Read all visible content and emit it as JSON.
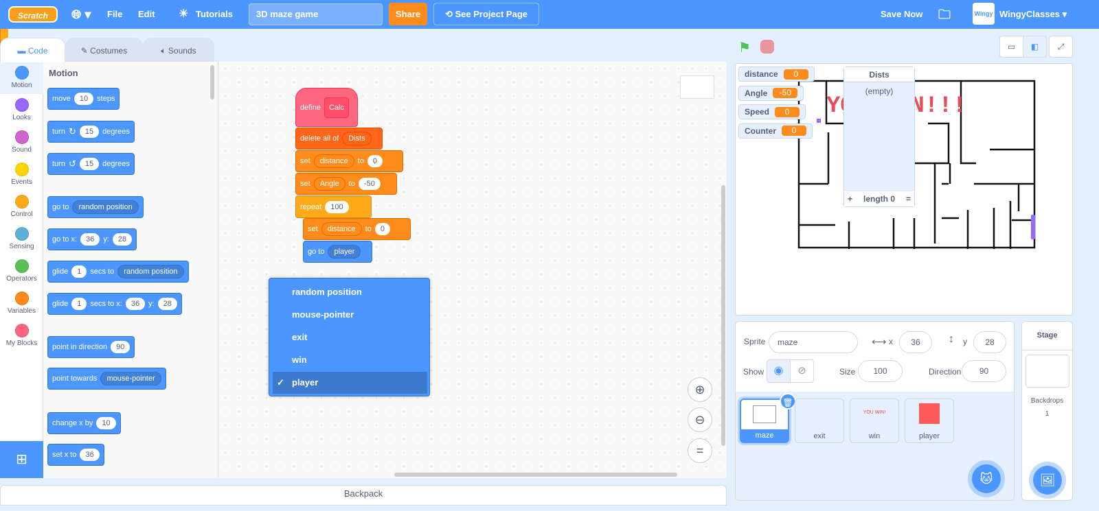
{
  "menubar": {
    "logo": "Scratch",
    "file": "File",
    "edit": "Edit",
    "tutorials": "Tutorials",
    "project_title": "3D maze game",
    "share": "Share",
    "see_project_page": "See Project Page",
    "save_now": "Save Now",
    "username": "WingyClasses",
    "avatar_text": "Wingy"
  },
  "tabs": [
    {
      "label": "Code"
    },
    {
      "label": "Costumes"
    },
    {
      "label": "Sounds"
    }
  ],
  "categories": [
    {
      "label": "Motion",
      "color": "#4c97ff"
    },
    {
      "label": "Looks",
      "color": "#9966ff"
    },
    {
      "label": "Sound",
      "color": "#cf63cf"
    },
    {
      "label": "Events",
      "color": "#ffd500"
    },
    {
      "label": "Control",
      "color": "#ffab19"
    },
    {
      "label": "Sensing",
      "color": "#5cb1d6"
    },
    {
      "label": "Operators",
      "color": "#59c059"
    },
    {
      "label": "Variables",
      "color": "#ff8c1a"
    },
    {
      "label": "My Blocks",
      "color": "#ff6680"
    }
  ],
  "palette": {
    "heading": "Motion",
    "blocks": {
      "move": [
        "move",
        "10",
        "steps"
      ],
      "turn_cw": [
        "turn",
        "15",
        "degrees"
      ],
      "turn_ccw": [
        "turn",
        "15",
        "degrees"
      ],
      "goto": [
        "go to",
        "random position"
      ],
      "gotoxy": [
        "go to x:",
        "36",
        "y:",
        "28"
      ],
      "glide": [
        "glide",
        "1",
        "secs to",
        "random position"
      ],
      "glidexy": [
        "glide",
        "1",
        "secs to x:",
        "36",
        "y:",
        "28"
      ],
      "point": [
        "point in direction",
        "90"
      ],
      "towards": [
        "point towards",
        "mouse-pointer"
      ],
      "changex": [
        "change x by",
        "10"
      ],
      "setx": [
        "set x to",
        "36"
      ]
    }
  },
  "script": {
    "define": [
      "define",
      "Calc"
    ],
    "delete": [
      "delete all of",
      "Dists"
    ],
    "set1": [
      "set",
      "distance",
      "to",
      "0"
    ],
    "set2": [
      "set",
      "Angle",
      "to",
      "-50"
    ],
    "repeat": [
      "repeat",
      "100"
    ],
    "set3": [
      "set",
      "distance",
      "to",
      "0"
    ],
    "goto": [
      "go to",
      "player"
    ]
  },
  "dropdown": {
    "options": [
      {
        "label": "random position"
      },
      {
        "label": "mouse-pointer"
      },
      {
        "label": "exit"
      },
      {
        "label": "win"
      },
      {
        "label": "player",
        "selected": true
      }
    ],
    "check": "✓"
  },
  "backpack": "Backpack",
  "monitors": [
    {
      "name": "distance",
      "value": "0"
    },
    {
      "name": "Angle",
      "value": "-50"
    },
    {
      "name": "Speed",
      "value": "0"
    },
    {
      "name": "Counter",
      "value": "0"
    }
  ],
  "list_monitor": {
    "title": "Dists",
    "empty": "(empty)",
    "add": "+",
    "length": "length 0",
    "resize": "="
  },
  "stage_text": "YOU WIN!!!",
  "sprite_info": {
    "sprite_label": "Sprite",
    "sprite_name": "maze",
    "x_label": "x",
    "x": "36",
    "y_label": "y",
    "y": "28",
    "show_label": "Show",
    "size_label": "Size",
    "size": "100",
    "direction_label": "Direction",
    "direction": "90"
  },
  "sprites": [
    {
      "name": "maze",
      "selected": true
    },
    {
      "name": "exit"
    },
    {
      "name": "win",
      "thumb_text": "YOU WIN!"
    },
    {
      "name": "player",
      "color": "#ff5a5a"
    }
  ],
  "stage_panel": {
    "title": "Stage",
    "backdrops_label": "Backdrops",
    "backdrops_count": "1"
  }
}
